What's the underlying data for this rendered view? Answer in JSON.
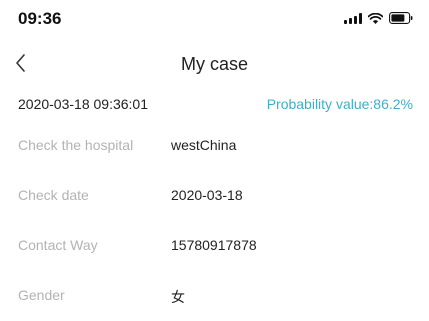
{
  "status_bar": {
    "time": "09:36",
    "icons": [
      "signal-icon",
      "wifi-icon",
      "battery-icon"
    ]
  },
  "nav": {
    "back_icon": "chevron-left-icon",
    "title": "My case"
  },
  "record": {
    "datetime": "2020-03-18 09:36:01",
    "probability": "Probability value:86.2%",
    "accent_color": "#3fb0c4"
  },
  "info": [
    {
      "label": "Check the hospital",
      "value": "westChina"
    },
    {
      "label": "Check date",
      "value": "2020-03-18"
    },
    {
      "label": "Contact Way",
      "value": "15780917878"
    },
    {
      "label": "Gender",
      "value": "女"
    }
  ]
}
